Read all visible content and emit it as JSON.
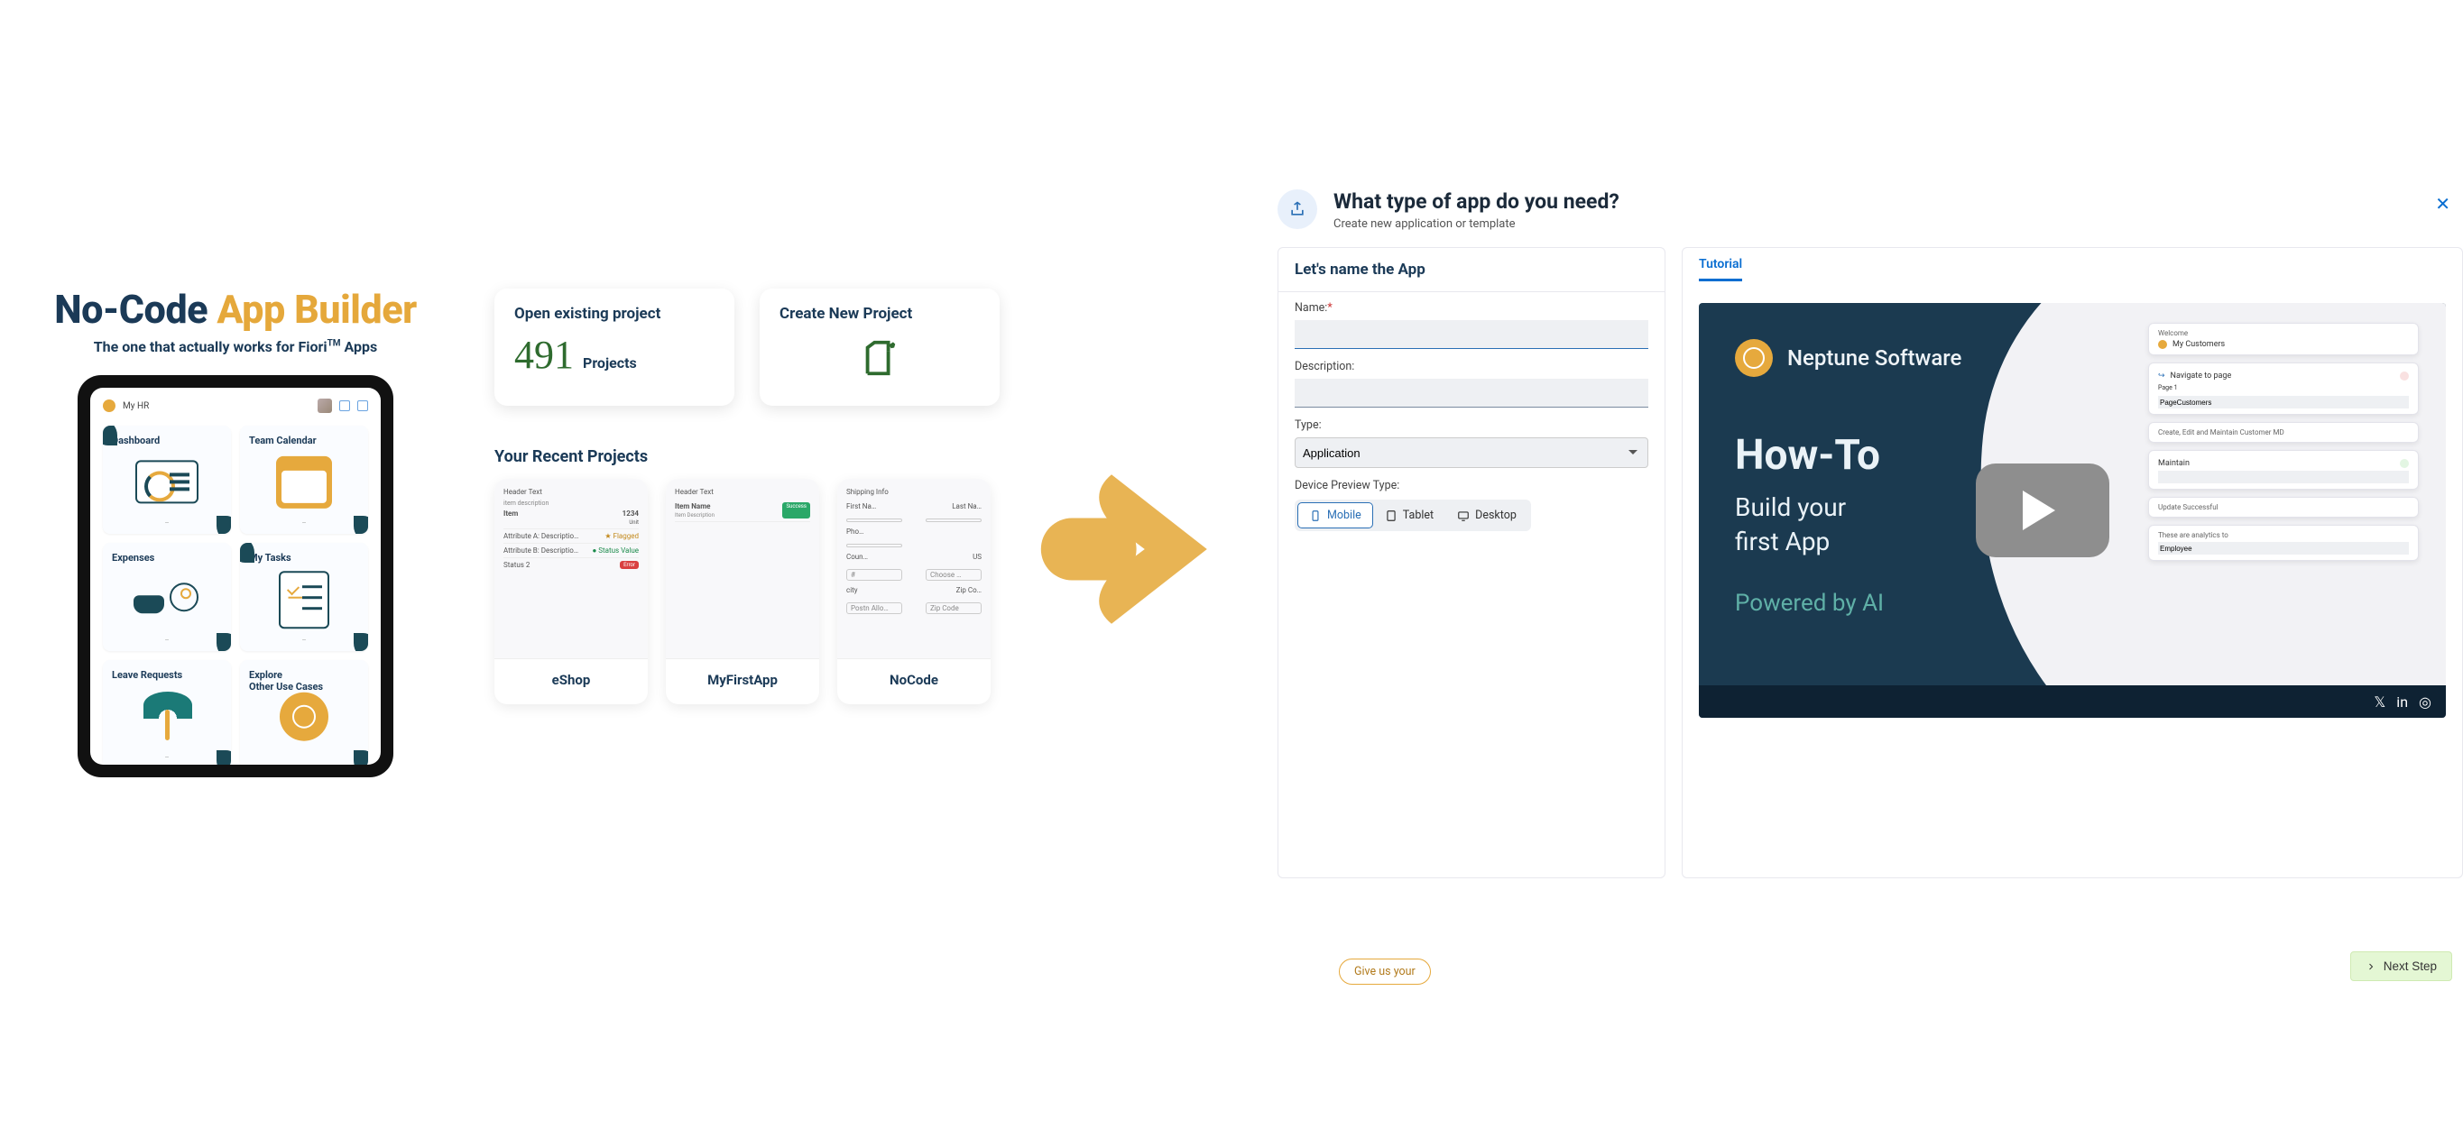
{
  "hero": {
    "title_a": "No-Code ",
    "title_b": "App Builder",
    "subtitle_pre": "The one that actually works for Fiori",
    "subtitle_tm": "TM",
    "subtitle_post": " Apps",
    "launchpad_title": "My HR",
    "tiles": [
      {
        "label": "Dashboard"
      },
      {
        "label": "Team Calendar"
      },
      {
        "label": "Expenses"
      },
      {
        "label": "My Tasks"
      },
      {
        "label": "Leave Requests"
      },
      {
        "label": "Explore\nOther Use Cases"
      }
    ]
  },
  "cards": {
    "open_title": "Open existing project",
    "open_count": "491",
    "open_unit": "Projects",
    "create_title": "Create New Project"
  },
  "recent": {
    "heading": "Your Recent Projects",
    "projects": [
      "eShop",
      "MyFirstApp",
      "NoCode"
    ],
    "thumb1": {
      "header": "Header Text",
      "sub": "item description",
      "item": "Item",
      "num": "1234",
      "unit": "Unit",
      "a": "Attribute A: Descriptio…",
      "b": "Attribute B: Descriptio…",
      "flag": "Flagged",
      "status": "Status Value",
      "statlab": "Status 2",
      "pill": "Error"
    },
    "thumb2": {
      "header": "Header Text",
      "name": "Item Name",
      "desc": "Item Description",
      "pill": "Success"
    },
    "thumb3": {
      "header": "Shipping Info",
      "rows": [
        "First Na…",
        "Last Na…",
        "Pho…",
        "",
        "Coun…",
        "US",
        "",
        "Choose …",
        "city",
        "Zip Co…",
        "Postn Allo…",
        "Zip Code"
      ]
    }
  },
  "dialog": {
    "title": "What type of app do you need?",
    "subtitle": "Create new application or template",
    "panel_title": "Let's name the App",
    "name_label": "Name:",
    "desc_label": "Description:",
    "type_label": "Type:",
    "type_value": "Application",
    "preview_label": "Device Preview Type:",
    "seg_mobile": "Mobile",
    "seg_tablet": "Tablet",
    "seg_desktop": "Desktop",
    "tab": "Tutorial",
    "brand": "Neptune Software",
    "howto_h": "How-To",
    "howto_s1": "Build your",
    "howto_s2": "first App",
    "howto_p": "Powered by AI",
    "card_welcome": "Welcome",
    "card_cust": "My Customers",
    "card_nav": "Navigate to page",
    "card_page": "Page 1",
    "card_pc": "PageCustomers",
    "card_crud": "Create, Edit and Maintain Customer MD",
    "card_maint": "Maintain",
    "card_upd": "Update Successful",
    "card_anal": "These are analytics to",
    "card_emp": "Employee",
    "next": "Next Step",
    "feedback": "Give us your"
  }
}
